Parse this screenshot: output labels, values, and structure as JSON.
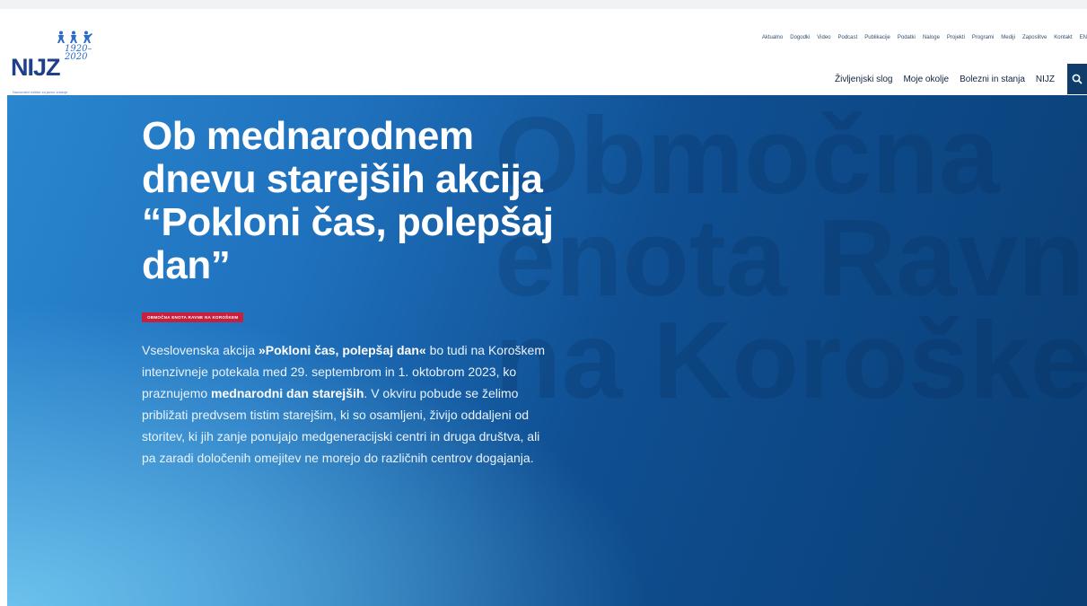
{
  "brand": {
    "logo_text": "NIJZ",
    "logo_script": "1920–2020",
    "logo_tagline": "Nacionalni inštitut za javno zdravje",
    "accent": "#1f3f8a",
    "people_icon": "people-icon"
  },
  "utility_nav": [
    "Aktualno",
    "Dogodki",
    "Video",
    "Podcast",
    "Publikacije",
    "Podatki",
    "Naloge",
    "Projekti",
    "Programi",
    "Mediji",
    "Zaposlitve",
    "Kontakt",
    "EN"
  ],
  "main_nav": [
    "Življenjski slog",
    "Moje okolje",
    "Bolezni in stanja",
    "NIJZ"
  ],
  "search": {
    "icon": "search-icon",
    "color": "#0e3d6b"
  },
  "hero": {
    "bg_words": "Območna\nenota Ravne\nna Koroškem",
    "title": "Ob mednarodnem dnevu starejših akcija “Pokloni čas, polepšaj dan”",
    "badge": "Območna enota Ravne na Koroškem",
    "badge_color": "#c6203d",
    "lead": {
      "p1": "Vseslovenska akcija ",
      "b1": "»Pokloni čas, polepšaj dan«",
      "p2": " bo tudi na Koroškem intenzivneje potekala med 29. septembrom in 1. oktobrom 2023, ko praznujemo ",
      "b2": "mednarodni dan starejših",
      "p3": ". V okviru pobude se želimo približati predvsem tistim starejšim, ki so osamljeni, živijo oddaljeni od storitev, ki jih zanje ponujajo medgeneracijski centri in druga društva, ali pa zaradi določenih omejitev ne morejo do različnih centrov dogajanja."
    }
  }
}
